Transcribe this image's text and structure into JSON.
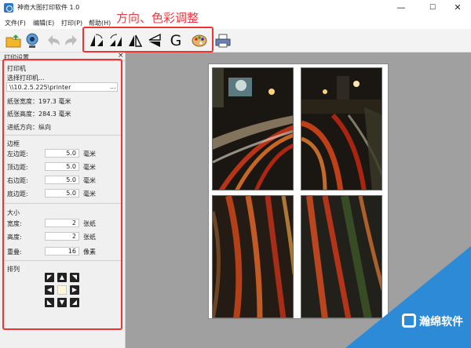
{
  "window": {
    "title": "神奇大图打印软件 1.0",
    "minimize": "—",
    "maximize": "☐",
    "close": "✕"
  },
  "menu": [
    {
      "label": "文件(F)"
    },
    {
      "label": "编辑(E)"
    },
    {
      "label": "打印(P)"
    },
    {
      "label": "帮助(H)"
    }
  ],
  "annotation": "方向、色彩调整",
  "toolbar": {
    "g_label": "G"
  },
  "panel": {
    "title": "打印设置",
    "close": "×",
    "printer_section": "打印机",
    "select_printer": "选择打印机...",
    "printer_path": "\\\\10.2.5.225\\printer",
    "browse": "...",
    "paper_width": "纸张宽度：197.3 毫米",
    "paper_height": "纸张高度：284.3 毫米",
    "feed_direction": "进纸方向：纵向",
    "margin_section": "边框",
    "margins": [
      {
        "label": "左边距:",
        "value": "5.0",
        "unit": "毫米"
      },
      {
        "label": "顶边距:",
        "value": "5.0",
        "unit": "毫米"
      },
      {
        "label": "右边距:",
        "value": "5.0",
        "unit": "毫米"
      },
      {
        "label": "底边距:",
        "value": "5.0",
        "unit": "毫米"
      }
    ],
    "size_section": "大小",
    "size": [
      {
        "label": "宽度:",
        "value": "2",
        "unit": "张纸"
      },
      {
        "label": "高度:",
        "value": "2",
        "unit": "张纸"
      },
      {
        "label": "重叠:",
        "value": "16",
        "unit": "像素"
      }
    ],
    "arrange_section": "排列",
    "arrows": {
      "nw": "◤",
      "n": "▲",
      "ne": "◥",
      "w": "◀",
      "e": "▶",
      "sw": "◣",
      "s": "▼",
      "se": "◢"
    }
  },
  "watermark": {
    "text": "瀚绵软件"
  }
}
